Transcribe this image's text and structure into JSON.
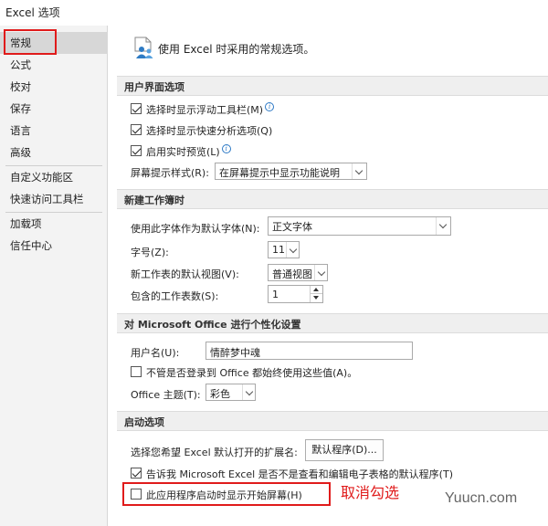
{
  "window": {
    "title": "Excel 选项"
  },
  "sidebar": {
    "items": [
      {
        "label": "常规",
        "active": true
      },
      {
        "label": "公式"
      },
      {
        "label": "校对"
      },
      {
        "label": "保存"
      },
      {
        "label": "语言"
      },
      {
        "label": "高级"
      },
      {
        "label": "自定义功能区"
      },
      {
        "label": "快速访问工具栏"
      },
      {
        "label": "加载项"
      },
      {
        "label": "信任中心"
      }
    ]
  },
  "header": {
    "text": "使用 Excel 时采用的常规选项。",
    "icon": "people-settings-icon"
  },
  "ui_section": {
    "title": "用户界面选项",
    "float_toolbar": {
      "label": "选择时显示浮动工具栏(M)",
      "checked": true
    },
    "quick_analysis": {
      "label": "选择时显示快速分析选项(Q)",
      "checked": true
    },
    "live_preview": {
      "label": "启用实时预览(L)",
      "checked": true
    },
    "tooltip_style": {
      "label": "屏幕提示样式(R):",
      "value": "在屏幕提示中显示功能说明"
    }
  },
  "workbook_section": {
    "title": "新建工作簿时",
    "font": {
      "label": "使用此字体作为默认字体(N):",
      "value": "正文字体"
    },
    "font_size": {
      "label": "字号(Z):",
      "value": "11"
    },
    "default_view": {
      "label": "新工作表的默认视图(V):",
      "value": "普通视图"
    },
    "sheet_count": {
      "label": "包含的工作表数(S):",
      "value": "1"
    }
  },
  "personalize_section": {
    "title": "对 Microsoft Office 进行个性化设置",
    "username": {
      "label": "用户名(U):",
      "value": "情醉梦中魂"
    },
    "always_use": {
      "label": "不管是否登录到 Office 都始终使用这些值(A)。",
      "checked": false
    },
    "theme": {
      "label": "Office 主题(T):",
      "value": "彩色"
    }
  },
  "startup_section": {
    "title": "启动选项",
    "extensions": {
      "label": "选择您希望 Excel 默认打开的扩展名:",
      "button": "默认程序(D)..."
    },
    "default_notice": {
      "label": "告诉我 Microsoft Excel 是否不是查看和编辑电子表格的默认程序(T)",
      "checked": true
    },
    "start_screen": {
      "label": "此应用程序启动时显示开始屏幕(H)",
      "checked": false
    }
  },
  "annotation": {
    "text": "取消勾选",
    "color": "#e01b1b"
  },
  "watermark": {
    "text": "Yuucn.com"
  }
}
